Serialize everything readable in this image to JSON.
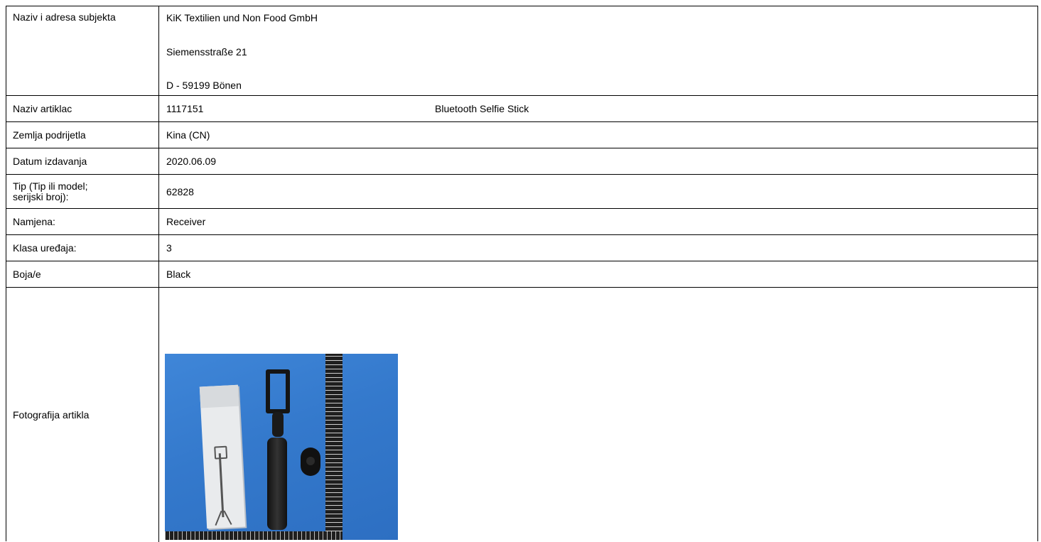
{
  "rows": {
    "subject": {
      "label": "Naziv i adresa subjekta",
      "lines": [
        "KiK Textilien und Non Food GmbH",
        "Siemensstraße 21",
        "D - 59199 Bönen"
      ]
    },
    "article": {
      "label": "Naziv artiklac",
      "number": "1117151",
      "name": "Bluetooth Selfie Stick"
    },
    "origin": {
      "label": "Zemlja podrijetla",
      "value": "Kina (CN)"
    },
    "issue_date": {
      "label": "Datum izdavanja",
      "value": "2020.06.09"
    },
    "type": {
      "label_line1": "Tip (Tip ili model;",
      "label_line2": "serijski broj):",
      "value": "62828"
    },
    "purpose": {
      "label": "Namjena:",
      "value": "Receiver"
    },
    "device_class": {
      "label": "Klasa uređaja:",
      "value": "3"
    },
    "colors": {
      "label": "Boja/e",
      "value": "Black"
    },
    "photo": {
      "label": "Fotografija artikla"
    }
  }
}
